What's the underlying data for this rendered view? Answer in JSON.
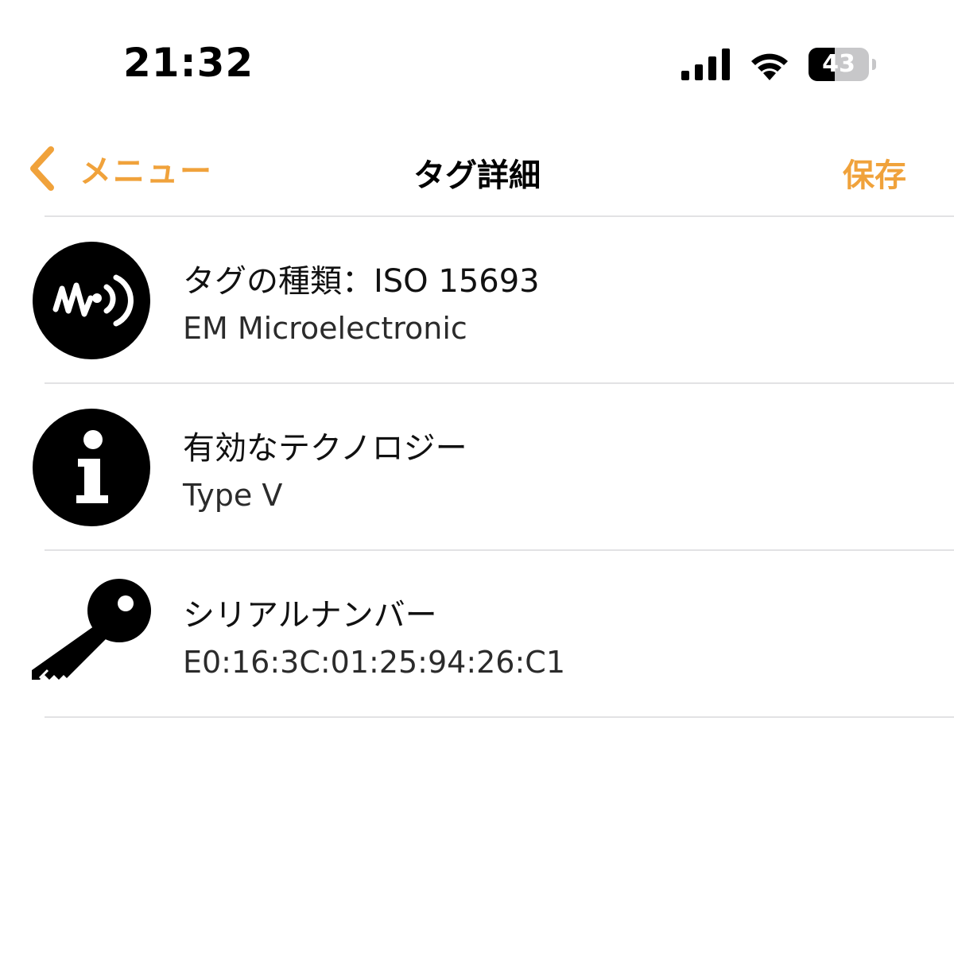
{
  "status_bar": {
    "time": "21:32",
    "signal_icon": "cellular-signal-icon",
    "wifi_icon": "wifi-icon",
    "battery_level": "43",
    "battery_fraction": 0.43
  },
  "nav": {
    "back_label": "メニュー",
    "title": "タグ詳細",
    "save_label": "保存",
    "accent_color": "#F0A23B"
  },
  "rows": [
    {
      "icon": "nfc-wave-icon",
      "title": "タグの種類：ISO 15693",
      "value": "EM Microelectronic"
    },
    {
      "icon": "info-icon",
      "title": "有効なテクノロジー",
      "value": "Type V"
    },
    {
      "icon": "key-icon",
      "title": "シリアルナンバー",
      "value": "E0:16:3C:01:25:94:26:C1"
    }
  ]
}
